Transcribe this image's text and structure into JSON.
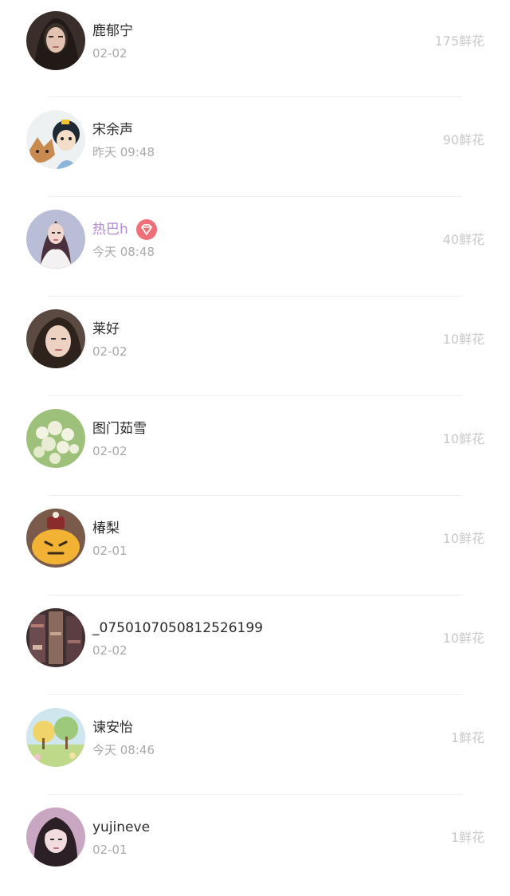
{
  "rows": [
    {
      "name": "鹿郁宁",
      "time": "02-02",
      "flowers": "175鲜花",
      "avatar": "portrait-dark-hair"
    },
    {
      "name": "宋余声",
      "time": "昨天 09:48",
      "flowers": "90鲜花",
      "avatar": "cartoon-couple"
    },
    {
      "name": "热巴h",
      "time": "今天 08:48",
      "flowers": "40鲜花",
      "avatar": "portrait-woman-white-dress",
      "vip": true,
      "badge": "diamond-icon"
    },
    {
      "name": "莱好",
      "time": "02-02",
      "flowers": "10鲜花",
      "avatar": "portrait-woman-selfie"
    },
    {
      "name": "图门茹雪",
      "time": "02-02",
      "flowers": "10鲜花",
      "avatar": "white-flowers"
    },
    {
      "name": "椿梨",
      "time": "02-01",
      "flowers": "10鲜花",
      "avatar": "pumpkin-toy"
    },
    {
      "name": "_0750107050812526199",
      "time": "02-02",
      "flowers": "10鲜花",
      "avatar": "bookshelf-room"
    },
    {
      "name": "谏安怡",
      "time": "今天 08:46",
      "flowers": "1鲜花",
      "avatar": "landscape-trees"
    },
    {
      "name": "yujineve",
      "time": "02-01",
      "flowers": "1鲜花",
      "avatar": "portrait-girl-bangs"
    }
  ],
  "colors": {
    "name": "#2b2b2b",
    "vip_name": "#b48ad8",
    "time": "#a9a9a9",
    "flowers": "#c9c9c9",
    "badge": "#ef6f78",
    "divider": "#efefef"
  }
}
